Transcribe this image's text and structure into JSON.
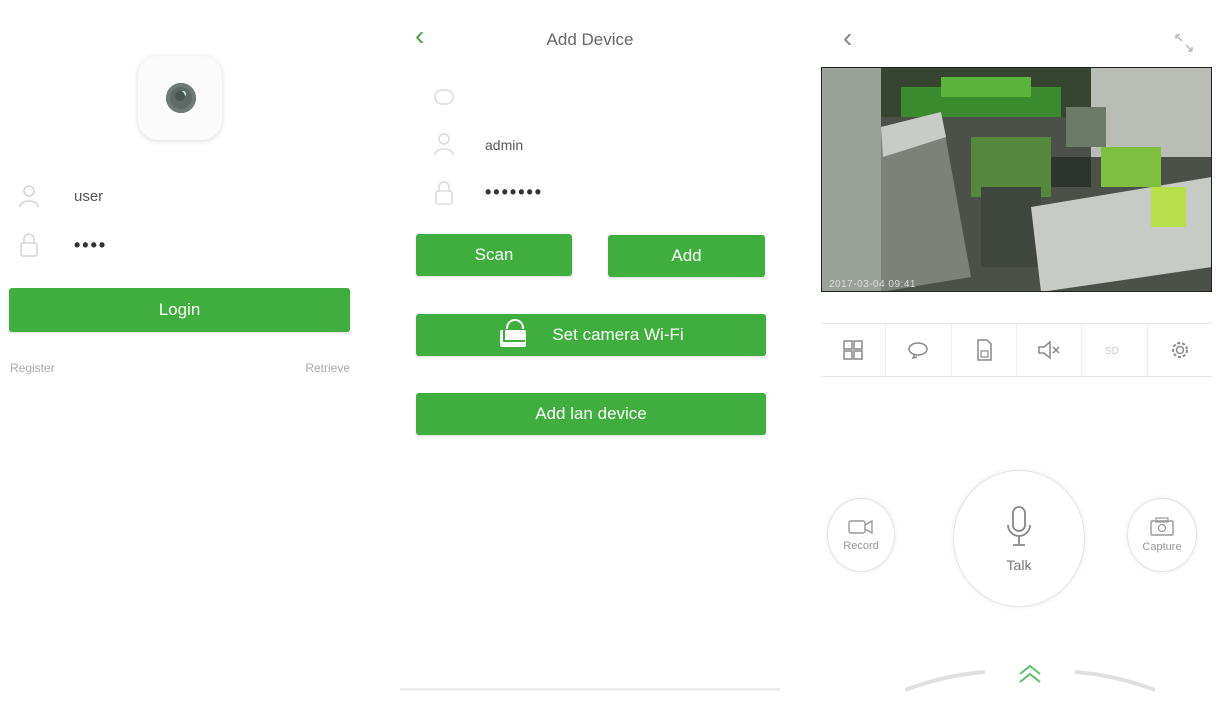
{
  "login": {
    "username_value": "user",
    "password_value": "••••",
    "login_label": "Login",
    "register_label": "Register",
    "forgot_label": "Retrieve"
  },
  "add_device": {
    "title": "Add Device",
    "username_value": "admin",
    "password_value": "•••••••",
    "scan_label": "Scan",
    "add_label": "Add",
    "wifi_label": "Set camera Wi-Fi",
    "lan_label": "Add lan device"
  },
  "live": {
    "timestamp": "2017-03-04 09:41",
    "toolbar": [
      "grid-icon",
      "rotate-icon",
      "sd-card-icon",
      "mute-icon",
      "quality-icon",
      "settings-icon"
    ],
    "record_label": "Record",
    "talk_label": "Talk",
    "capture_label": "Capture"
  },
  "colors": {
    "accent": "#3fae3f",
    "text": "#555555"
  }
}
